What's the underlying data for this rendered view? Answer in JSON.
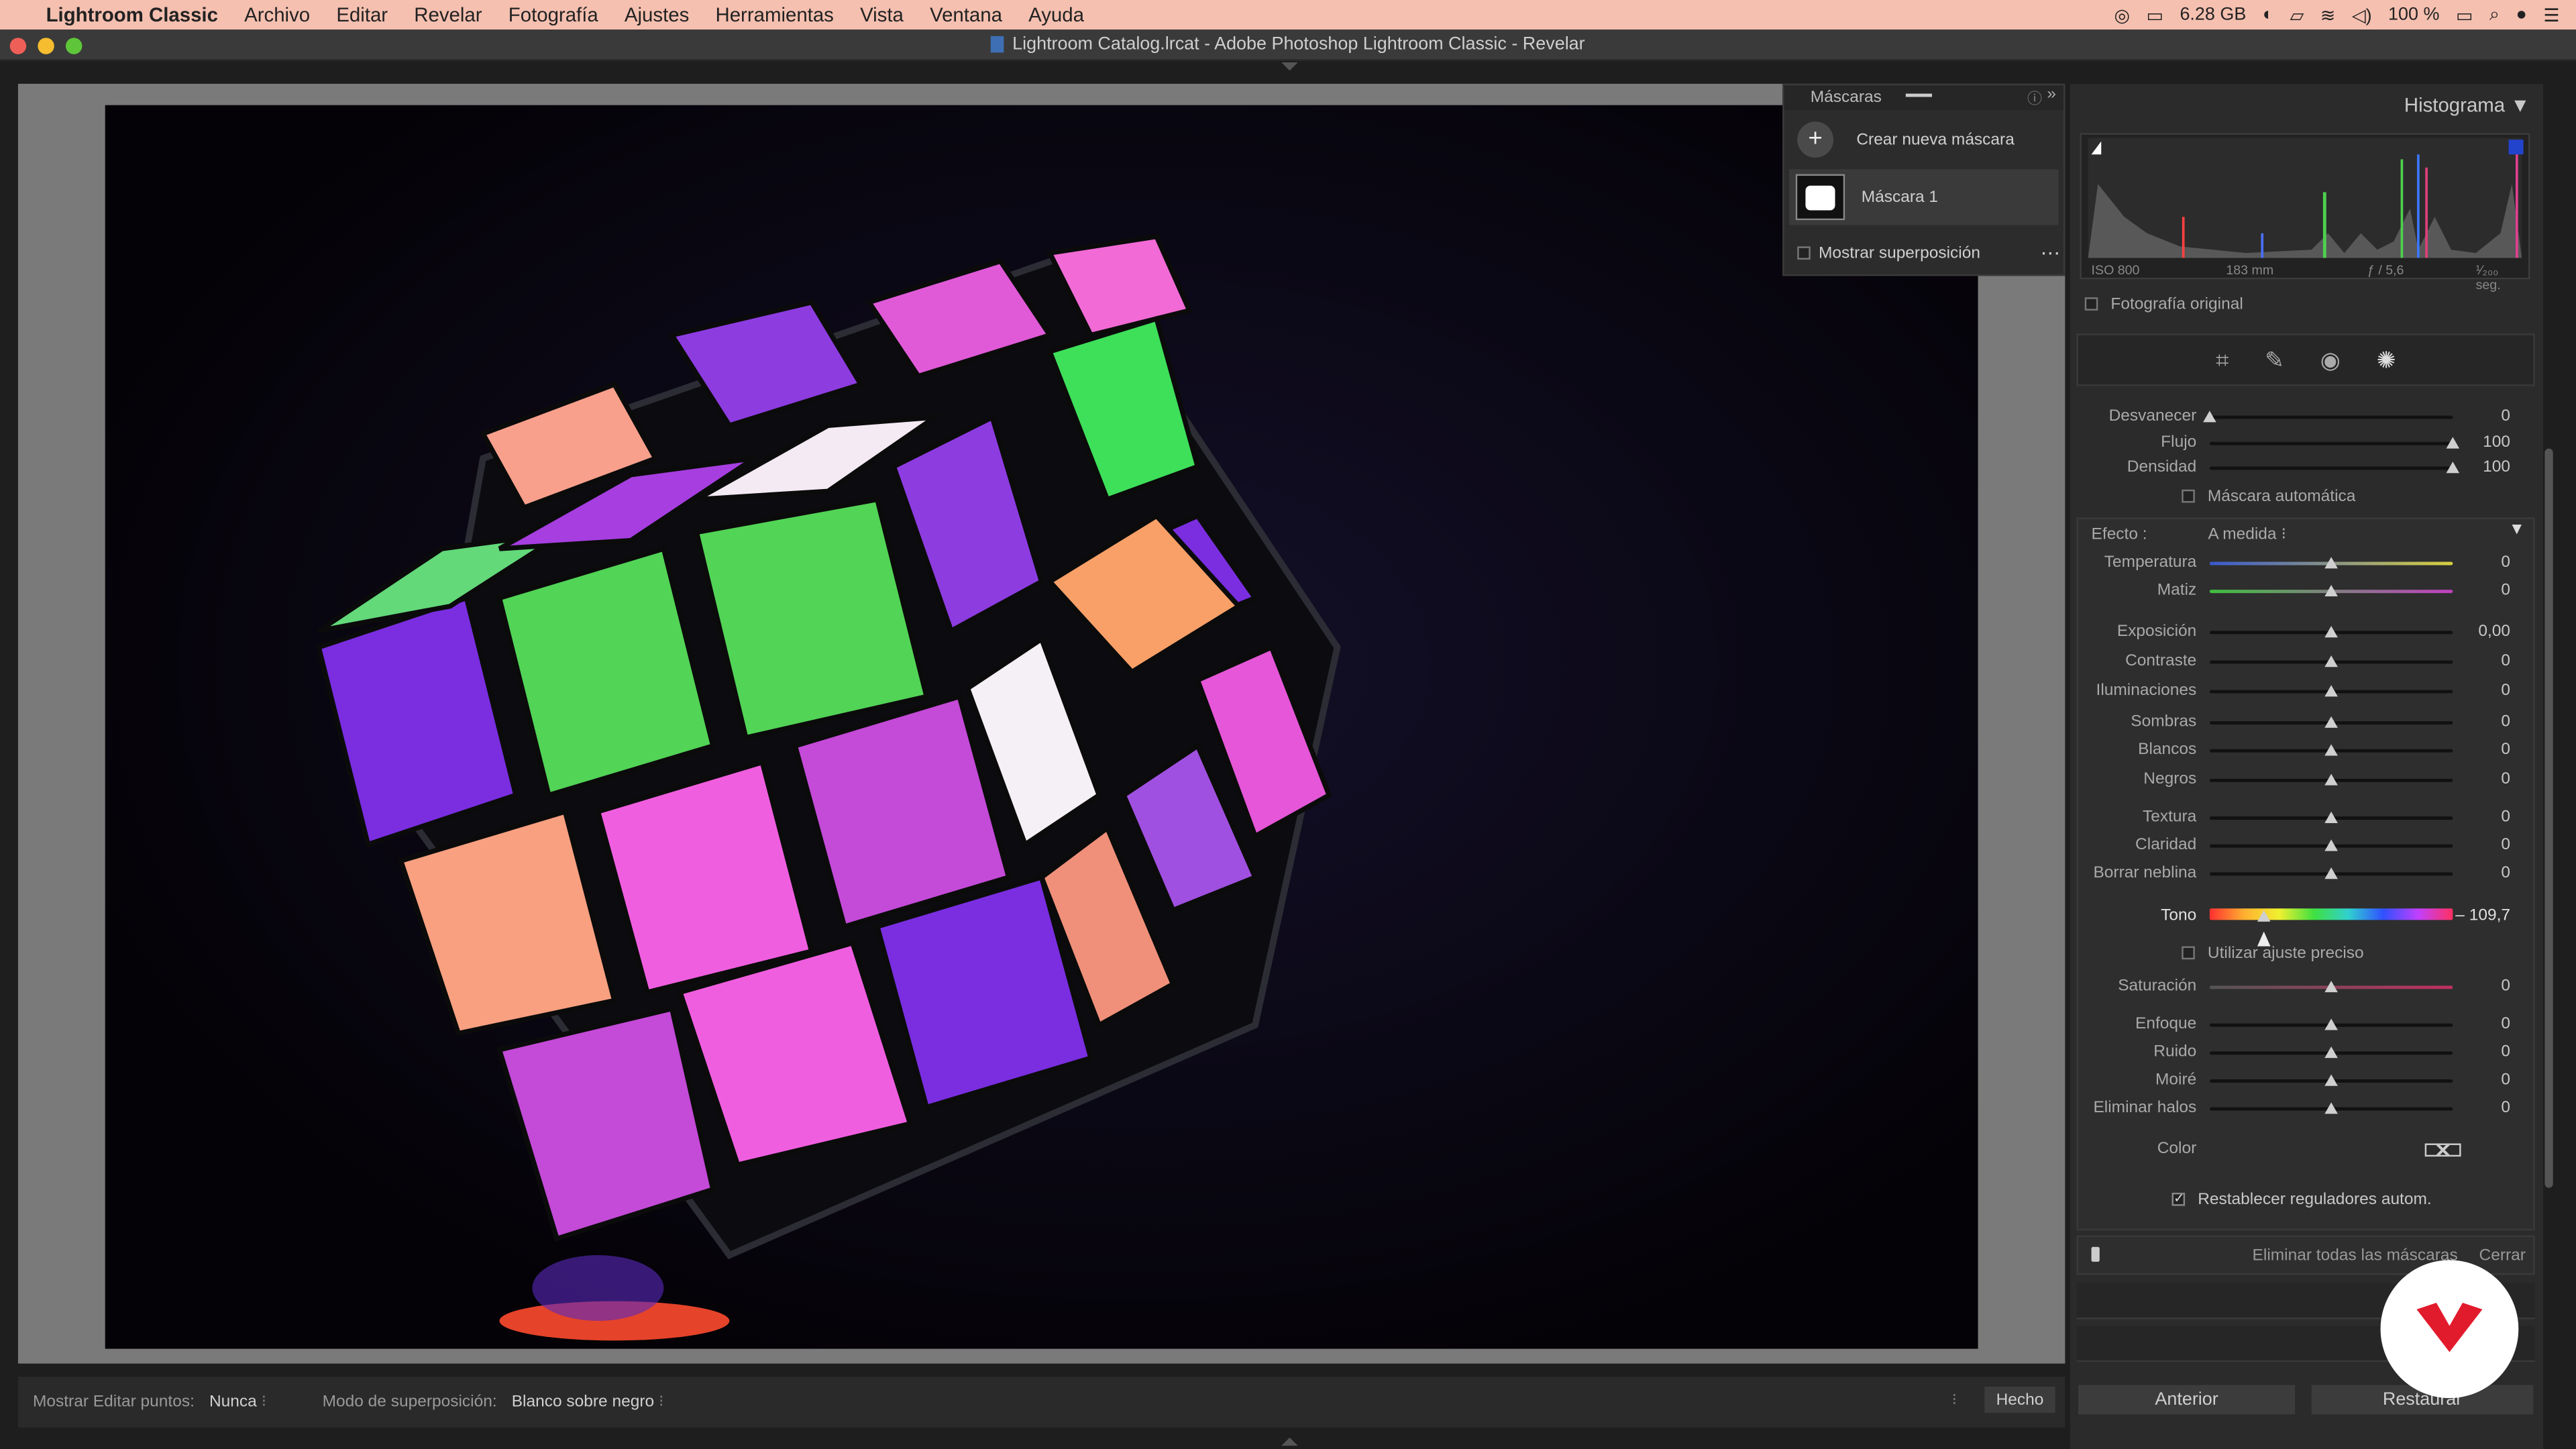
{
  "menubar": {
    "app_name": "Lightroom Classic",
    "items": [
      "Archivo",
      "Editar",
      "Revelar",
      "Fotografía",
      "Ajustes",
      "Herramientas",
      "Vista",
      "Ventana",
      "Ayuda"
    ],
    "memory": "6.28 GB",
    "battery": "100 %"
  },
  "window": {
    "title": "Lightroom Catalog.lrcat - Adobe Photoshop Lightroom Classic - Revelar"
  },
  "masks_panel": {
    "title": "Máscaras",
    "create_label": "Crear nueva máscara",
    "mask_name": "Máscara 1",
    "overlay_label": "Mostrar superposición"
  },
  "histogram": {
    "title": "Histograma",
    "iso": "ISO 800",
    "focal": "183 mm",
    "aperture": "ƒ / 5,6",
    "shutter": "¹⁄₂₀₀ seg.",
    "original_label": "Fotografía original"
  },
  "brush": {
    "rows": [
      {
        "label": "Desvanecer",
        "value": "0",
        "pos": 0.0
      },
      {
        "label": "Flujo",
        "value": "100",
        "pos": 1.0
      },
      {
        "label": "Densidad",
        "value": "100",
        "pos": 1.0
      }
    ],
    "auto_mask_label": "Máscara automática"
  },
  "effect": {
    "label": "Efecto :",
    "preset": "A medida",
    "groups": [
      [
        {
          "label": "Temperatura",
          "value": "0",
          "pos": 0.5
        },
        {
          "label": "Matiz",
          "value": "0",
          "pos": 0.5
        }
      ],
      [
        {
          "label": "Exposición",
          "value": "0,00",
          "pos": 0.5
        },
        {
          "label": "Contraste",
          "value": "0",
          "pos": 0.5
        },
        {
          "label": "Iluminaciones",
          "value": "0",
          "pos": 0.5
        },
        {
          "label": "Sombras",
          "value": "0",
          "pos": 0.5
        },
        {
          "label": "Blancos",
          "value": "0",
          "pos": 0.5
        },
        {
          "label": "Negros",
          "value": "0",
          "pos": 0.5
        }
      ],
      [
        {
          "label": "Textura",
          "value": "0",
          "pos": 0.5
        },
        {
          "label": "Claridad",
          "value": "0",
          "pos": 0.5
        },
        {
          "label": "Borrar neblina",
          "value": "0",
          "pos": 0.5
        }
      ]
    ],
    "tone": {
      "label": "Tono",
      "value": "– 109,7",
      "pos": 0.22
    },
    "fine_label": "Utilizar ajuste preciso",
    "saturation": {
      "label": "Saturación",
      "value": "0",
      "pos": 0.5
    },
    "detail": [
      {
        "label": "Enfoque",
        "value": "0",
        "pos": 0.5
      },
      {
        "label": "Ruido",
        "value": "0",
        "pos": 0.5
      },
      {
        "label": "Moiré",
        "value": "0",
        "pos": 0.5
      },
      {
        "label": "Eliminar halos",
        "value": "0",
        "pos": 0.5
      }
    ],
    "color_label": "Color",
    "reset_label": "Restablecer reguladores autom."
  },
  "footer": {
    "delete_all": "Eliminar todas las máscaras",
    "close": "Cerrar",
    "prev": "Anterior",
    "reset": "Restaurar"
  },
  "toolbar": {
    "edit_points_label": "Mostrar Editar puntos:",
    "edit_points_value": "Nunca",
    "overlay_mode_label": "Modo de superposición:",
    "overlay_mode_value": "Blanco sobre negro",
    "done": "Hecho"
  }
}
